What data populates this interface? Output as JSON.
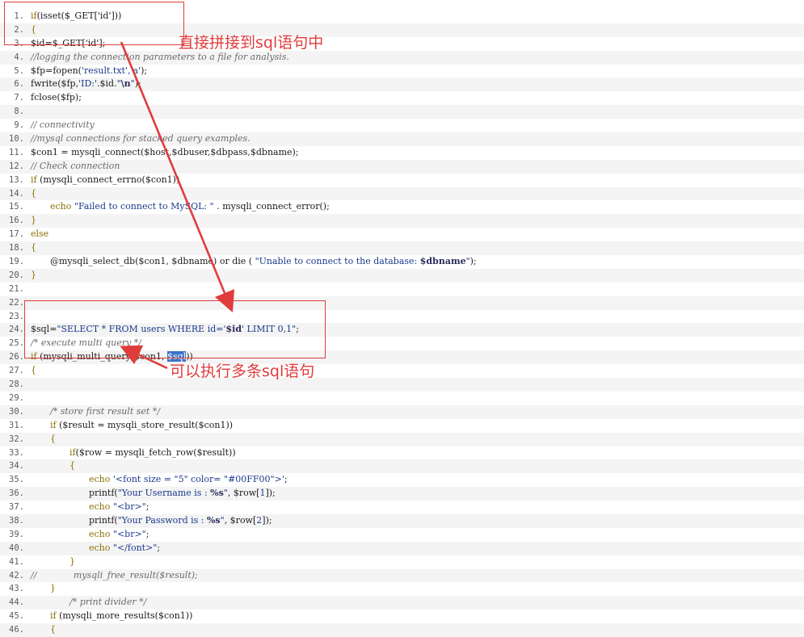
{
  "code": {
    "lines": [
      {
        "num": "1.",
        "indent": 0,
        "tokens": [
          {
            "t": "if",
            "c": "kw"
          },
          {
            "t": "(isset($_GET['id']))",
            "c": "plain"
          }
        ]
      },
      {
        "num": "2.",
        "indent": 0,
        "tokens": [
          {
            "t": "{",
            "c": "kw"
          }
        ]
      },
      {
        "num": "3.",
        "indent": 0,
        "tokens": [
          {
            "t": "$id=$_GET['id'];",
            "c": "plain"
          }
        ]
      },
      {
        "num": "4.",
        "indent": 0,
        "tokens": [
          {
            "t": "//logging the connection parameters to a file for analysis.",
            "c": "com"
          }
        ]
      },
      {
        "num": "5.",
        "indent": 0,
        "tokens": [
          {
            "t": "$fp=fopen(",
            "c": "plain"
          },
          {
            "t": "'result.txt','a'",
            "c": "str"
          },
          {
            "t": ");",
            "c": "plain"
          }
        ]
      },
      {
        "num": "6.",
        "indent": 0,
        "tokens": [
          {
            "t": "fwrite($fp,",
            "c": "plain"
          },
          {
            "t": "'ID:'",
            "c": "str"
          },
          {
            "t": ".$id.",
            "c": "plain"
          },
          {
            "t": "\"",
            "c": "str"
          },
          {
            "t": "\\n",
            "c": "bold"
          },
          {
            "t": "\"",
            "c": "str"
          },
          {
            "t": ");",
            "c": "plain"
          }
        ]
      },
      {
        "num": "7.",
        "indent": 0,
        "tokens": [
          {
            "t": "fclose($fp);",
            "c": "plain"
          }
        ]
      },
      {
        "num": "8.",
        "indent": 0,
        "tokens": []
      },
      {
        "num": "9.",
        "indent": 0,
        "tokens": [
          {
            "t": "// connectivity",
            "c": "com"
          }
        ]
      },
      {
        "num": "10.",
        "indent": 0,
        "tokens": [
          {
            "t": "//mysql connections for stacked query examples.",
            "c": "com"
          }
        ]
      },
      {
        "num": "11.",
        "indent": 0,
        "tokens": [
          {
            "t": "$con1 = mysqli_connect($host,$dbuser,$dbpass,$dbname);",
            "c": "plain"
          }
        ]
      },
      {
        "num": "12.",
        "indent": 0,
        "tokens": [
          {
            "t": "// Check connection",
            "c": "com"
          }
        ]
      },
      {
        "num": "13.",
        "indent": 0,
        "tokens": [
          {
            "t": "if",
            "c": "kw"
          },
          {
            "t": " (mysqli_connect_errno($con1))",
            "c": "plain"
          }
        ]
      },
      {
        "num": "14.",
        "indent": 0,
        "tokens": [
          {
            "t": "{",
            "c": "kw"
          }
        ]
      },
      {
        "num": "15.",
        "indent": 1,
        "tokens": [
          {
            "t": "echo",
            "c": "kw"
          },
          {
            "t": " ",
            "c": "plain"
          },
          {
            "t": "\"Failed to connect to MySQL: \"",
            "c": "str"
          },
          {
            "t": " . mysqli_connect_error();",
            "c": "plain"
          }
        ]
      },
      {
        "num": "16.",
        "indent": 0,
        "tokens": [
          {
            "t": "}",
            "c": "kw"
          }
        ]
      },
      {
        "num": "17.",
        "indent": 0,
        "tokens": [
          {
            "t": "else",
            "c": "kw"
          }
        ]
      },
      {
        "num": "18.",
        "indent": 0,
        "tokens": [
          {
            "t": "{",
            "c": "kw"
          }
        ]
      },
      {
        "num": "19.",
        "indent": 1,
        "tokens": [
          {
            "t": "@mysqli_select_db($con1, $dbname) or die ( ",
            "c": "plain"
          },
          {
            "t": "\"Unable to connect to the database: ",
            "c": "str"
          },
          {
            "t": "$dbname",
            "c": "bold"
          },
          {
            "t": "\"",
            "c": "str"
          },
          {
            "t": ");",
            "c": "plain"
          }
        ]
      },
      {
        "num": "20.",
        "indent": 0,
        "tokens": [
          {
            "t": "}",
            "c": "kw"
          }
        ]
      },
      {
        "num": "21.",
        "indent": 0,
        "tokens": []
      },
      {
        "num": "22.",
        "indent": 0,
        "tokens": []
      },
      {
        "num": "23.",
        "indent": 0,
        "tokens": []
      },
      {
        "num": "24.",
        "indent": 0,
        "tokens": [
          {
            "t": "$sql=",
            "c": "plain"
          },
          {
            "t": "\"SELECT * FROM users WHERE id='",
            "c": "str"
          },
          {
            "t": "$id",
            "c": "bold"
          },
          {
            "t": "' LIMIT 0,1\"",
            "c": "str"
          },
          {
            "t": ";",
            "c": "plain"
          }
        ]
      },
      {
        "num": "25.",
        "indent": 0,
        "tokens": [
          {
            "t": "/* execute multi query */",
            "c": "com"
          }
        ]
      },
      {
        "num": "26.",
        "indent": 0,
        "tokens": [
          {
            "t": "if",
            "c": "kw"
          },
          {
            "t": " (mysqli_multi_query($con1, ",
            "c": "plain"
          },
          {
            "t": "$sql",
            "c": "sel"
          },
          {
            "t": "))",
            "c": "plain"
          }
        ]
      },
      {
        "num": "27.",
        "indent": 0,
        "tokens": [
          {
            "t": "{",
            "c": "kw"
          }
        ]
      },
      {
        "num": "28.",
        "indent": 0,
        "tokens": []
      },
      {
        "num": "29.",
        "indent": 0,
        "tokens": []
      },
      {
        "num": "30.",
        "indent": 1,
        "tokens": [
          {
            "t": "/* store first result set */",
            "c": "com"
          }
        ]
      },
      {
        "num": "31.",
        "indent": 1,
        "tokens": [
          {
            "t": "if",
            "c": "kw"
          },
          {
            "t": " ($result = mysqli_store_result($con1))",
            "c": "plain"
          }
        ]
      },
      {
        "num": "32.",
        "indent": 1,
        "tokens": [
          {
            "t": "{",
            "c": "kw"
          }
        ]
      },
      {
        "num": "33.",
        "indent": 2,
        "tokens": [
          {
            "t": "if",
            "c": "kw"
          },
          {
            "t": "($row = mysqli_fetch_row($result))",
            "c": "plain"
          }
        ]
      },
      {
        "num": "34.",
        "indent": 2,
        "tokens": [
          {
            "t": "{",
            "c": "kw"
          }
        ]
      },
      {
        "num": "35.",
        "indent": 3,
        "tokens": [
          {
            "t": "echo",
            "c": "kw"
          },
          {
            "t": " ",
            "c": "plain"
          },
          {
            "t": "'<font size = \"5\" color= \"#00FF00\">'",
            "c": "str"
          },
          {
            "t": ";",
            "c": "plain"
          }
        ]
      },
      {
        "num": "36.",
        "indent": 3,
        "tokens": [
          {
            "t": "printf(",
            "c": "plain"
          },
          {
            "t": "\"Your Username is : ",
            "c": "str"
          },
          {
            "t": "%s",
            "c": "bold"
          },
          {
            "t": "\"",
            "c": "str"
          },
          {
            "t": ", $row[",
            "c": "plain"
          },
          {
            "t": "1",
            "c": "str"
          },
          {
            "t": "]);",
            "c": "plain"
          }
        ]
      },
      {
        "num": "37.",
        "indent": 3,
        "tokens": [
          {
            "t": "echo",
            "c": "kw"
          },
          {
            "t": " ",
            "c": "plain"
          },
          {
            "t": "\"<br>\"",
            "c": "str"
          },
          {
            "t": ";",
            "c": "plain"
          }
        ]
      },
      {
        "num": "38.",
        "indent": 3,
        "tokens": [
          {
            "t": "printf(",
            "c": "plain"
          },
          {
            "t": "\"Your Password is : ",
            "c": "str"
          },
          {
            "t": "%s",
            "c": "bold"
          },
          {
            "t": "\"",
            "c": "str"
          },
          {
            "t": ", $row[",
            "c": "plain"
          },
          {
            "t": "2",
            "c": "str"
          },
          {
            "t": "]);",
            "c": "plain"
          }
        ]
      },
      {
        "num": "39.",
        "indent": 3,
        "tokens": [
          {
            "t": "echo",
            "c": "kw"
          },
          {
            "t": " ",
            "c": "plain"
          },
          {
            "t": "\"<br>\"",
            "c": "str"
          },
          {
            "t": ";",
            "c": "plain"
          }
        ]
      },
      {
        "num": "40.",
        "indent": 3,
        "tokens": [
          {
            "t": "echo",
            "c": "kw"
          },
          {
            "t": " ",
            "c": "plain"
          },
          {
            "t": "\"</font>\"",
            "c": "str"
          },
          {
            "t": ";",
            "c": "plain"
          }
        ]
      },
      {
        "num": "41.",
        "indent": 2,
        "tokens": [
          {
            "t": "}",
            "c": "kw"
          }
        ]
      },
      {
        "num": "42.",
        "indent": 0,
        "tokens": [
          {
            "t": "//             mysqli_free_result($result);",
            "c": "com"
          }
        ]
      },
      {
        "num": "43.",
        "indent": 1,
        "tokens": [
          {
            "t": "}",
            "c": "kw"
          }
        ]
      },
      {
        "num": "44.",
        "indent": 2,
        "tokens": [
          {
            "t": "/* print divider */",
            "c": "com"
          }
        ]
      },
      {
        "num": "45.",
        "indent": 1,
        "tokens": [
          {
            "t": "if",
            "c": "kw"
          },
          {
            "t": " (mysqli_more_results($con1))",
            "c": "plain"
          }
        ]
      },
      {
        "num": "46.",
        "indent": 1,
        "tokens": [
          {
            "t": "{",
            "c": "kw"
          }
        ]
      }
    ]
  },
  "annotations": {
    "concat_note": "直接拼接到sql语句中",
    "multi_note": "可以执行多条sql语句"
  },
  "colors": {
    "annotation_red": "#e03c3c",
    "selection_blue": "#3b72c9",
    "keyword": "#8a7000",
    "string": "#1a3a8a",
    "comment": "#6a6a6a"
  }
}
